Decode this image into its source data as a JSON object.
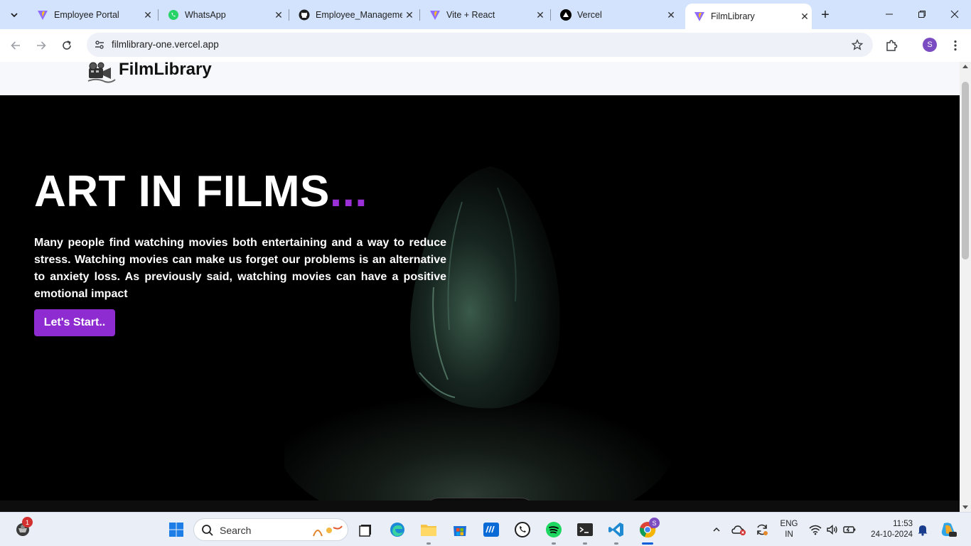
{
  "browser": {
    "tabs": [
      {
        "label": "Employee Portal",
        "icon": "vite-icon"
      },
      {
        "label": "WhatsApp",
        "icon": "whatsapp-icon"
      },
      {
        "label": "Employee_Manageme",
        "icon": "github-icon"
      },
      {
        "label": "Vite + React",
        "icon": "vite-icon"
      },
      {
        "label": "Vercel",
        "icon": "vercel-icon"
      },
      {
        "label": "FilmLibrary",
        "icon": "vite-icon",
        "active": true
      }
    ],
    "close_glyph": "✕",
    "new_tab_glyph": "+",
    "url": "filmlibrary-one.vercel.app",
    "profile_initial": "S"
  },
  "site": {
    "logo_text": "FilmLibrary",
    "hero_title": "ART IN FILMS",
    "hero_title_dots": "...",
    "hero_description": "Many people find watching movies both entertaining and a way to reduce stress. Watching movies can make us forget our problems is an alternative to anxiety loss. As previously said, watching movies can have a positive emotional impact",
    "cta_label": "Let's Start..",
    "accent_color": "#9b30d9"
  },
  "taskbar": {
    "search_placeholder": "Search",
    "notification_count": "1",
    "lang_line1": "ENG",
    "lang_line2": "IN",
    "time": "11:53",
    "date": "24-10-2024",
    "chrome_profile_initial": "S"
  }
}
